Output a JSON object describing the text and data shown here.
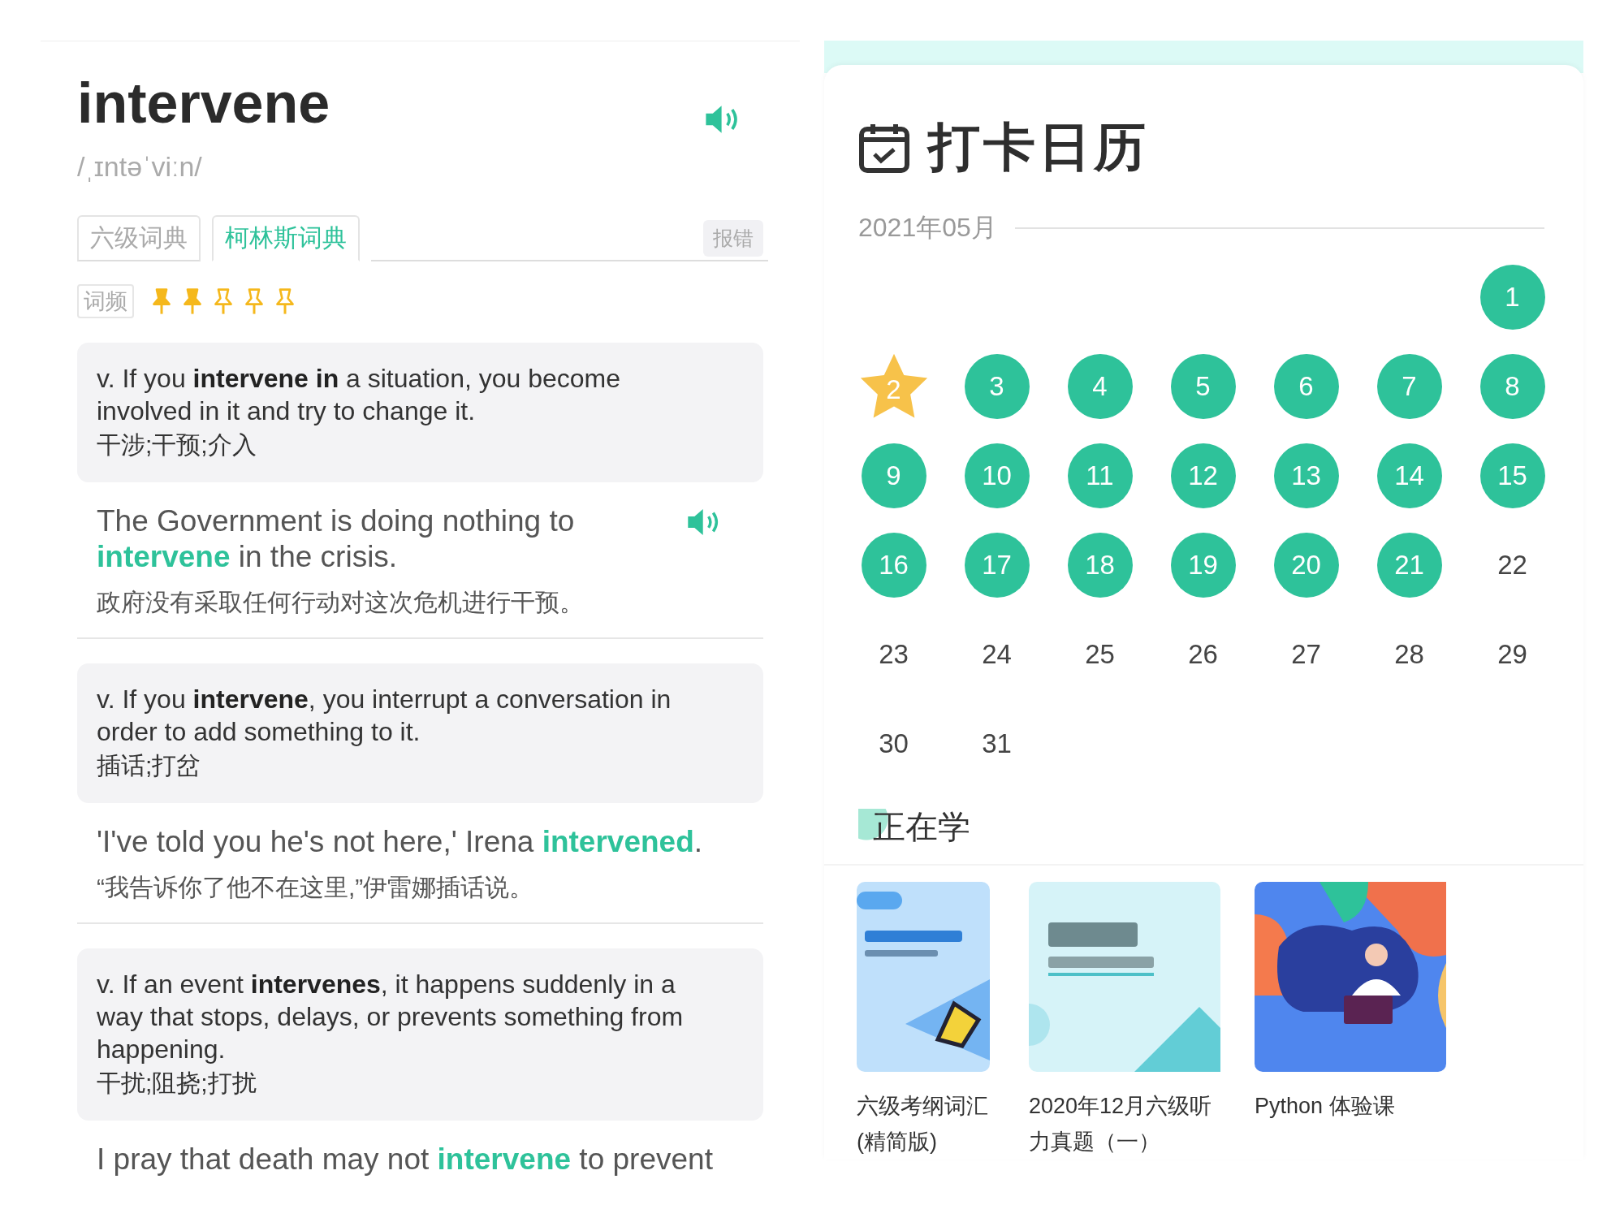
{
  "dictionary": {
    "word": "intervene",
    "phonetic": "/ˌɪntəˈviːn/",
    "tabs": [
      {
        "label": "六级词典",
        "selected": false
      },
      {
        "label": "柯林斯词典",
        "selected": true
      }
    ],
    "report_button": "报错",
    "frequency": {
      "label": "词频",
      "stars": 2
    },
    "senses": [
      {
        "definition": "v. If you **intervene in** a situation, you become involved in it and try to change it.",
        "translation": "干涉;干预;介入",
        "example": "The Government is doing nothing to **intervene** in the crisis.",
        "example_translation": "政府没有采取任何行动对这次危机进行干预。",
        "audio": true
      },
      {
        "definition": "v. If you **intervene**, you interrupt a conversation in order to add something to it.",
        "translation": "插话;打岔",
        "example": "'I've told you he's not here,' Irena **intervened**.",
        "example_translation": "“我告诉你了他不在这里,”伊雷娜插话说。",
        "audio": false
      },
      {
        "definition": "v. If an event **intervenes**, it happens suddenly in a way that stops, delays, or prevents something from happening.",
        "translation": "干扰;阻挠;打扰",
        "example": "I pray that death may not **intervene** to prevent",
        "audio": false
      }
    ]
  },
  "calendar": {
    "title": "打卡日历",
    "month": "2021年05月",
    "days": [
      {
        "label": "1",
        "kind": "checked"
      },
      {
        "label": "2",
        "kind": "star"
      },
      {
        "label": "3",
        "kind": "checked"
      },
      {
        "label": "4",
        "kind": "checked"
      },
      {
        "label": "5",
        "kind": "checked"
      },
      {
        "label": "6",
        "kind": "checked"
      },
      {
        "label": "7",
        "kind": "checked"
      },
      {
        "label": "8",
        "kind": "checked"
      },
      {
        "label": "9",
        "kind": "checked"
      },
      {
        "label": "10",
        "kind": "checked"
      },
      {
        "label": "11",
        "kind": "checked"
      },
      {
        "label": "12",
        "kind": "checked"
      },
      {
        "label": "13",
        "kind": "checked"
      },
      {
        "label": "14",
        "kind": "checked"
      },
      {
        "label": "15",
        "kind": "checked"
      },
      {
        "label": "16",
        "kind": "checked"
      },
      {
        "label": "17",
        "kind": "checked"
      },
      {
        "label": "18",
        "kind": "checked"
      },
      {
        "label": "19",
        "kind": "checked"
      },
      {
        "label": "20",
        "kind": "checked"
      },
      {
        "label": "21",
        "kind": "checked"
      },
      {
        "label": "22",
        "kind": "plain"
      },
      {
        "label": "23",
        "kind": "plain"
      },
      {
        "label": "24",
        "kind": "plain"
      },
      {
        "label": "25",
        "kind": "plain"
      },
      {
        "label": "26",
        "kind": "plain"
      },
      {
        "label": "27",
        "kind": "plain"
      },
      {
        "label": "28",
        "kind": "plain"
      },
      {
        "label": "29",
        "kind": "plain"
      },
      {
        "label": "30",
        "kind": "plain"
      },
      {
        "label": "31",
        "kind": "plain"
      }
    ]
  },
  "learning": {
    "title": "正在学",
    "courses": [
      {
        "name": "六级考纲词汇(精简版)",
        "kind": "pen"
      },
      {
        "name": "2020年12月六级听力真题（一）",
        "kind": "listening"
      },
      {
        "name": "Python 体验课",
        "kind": "python"
      }
    ]
  }
}
